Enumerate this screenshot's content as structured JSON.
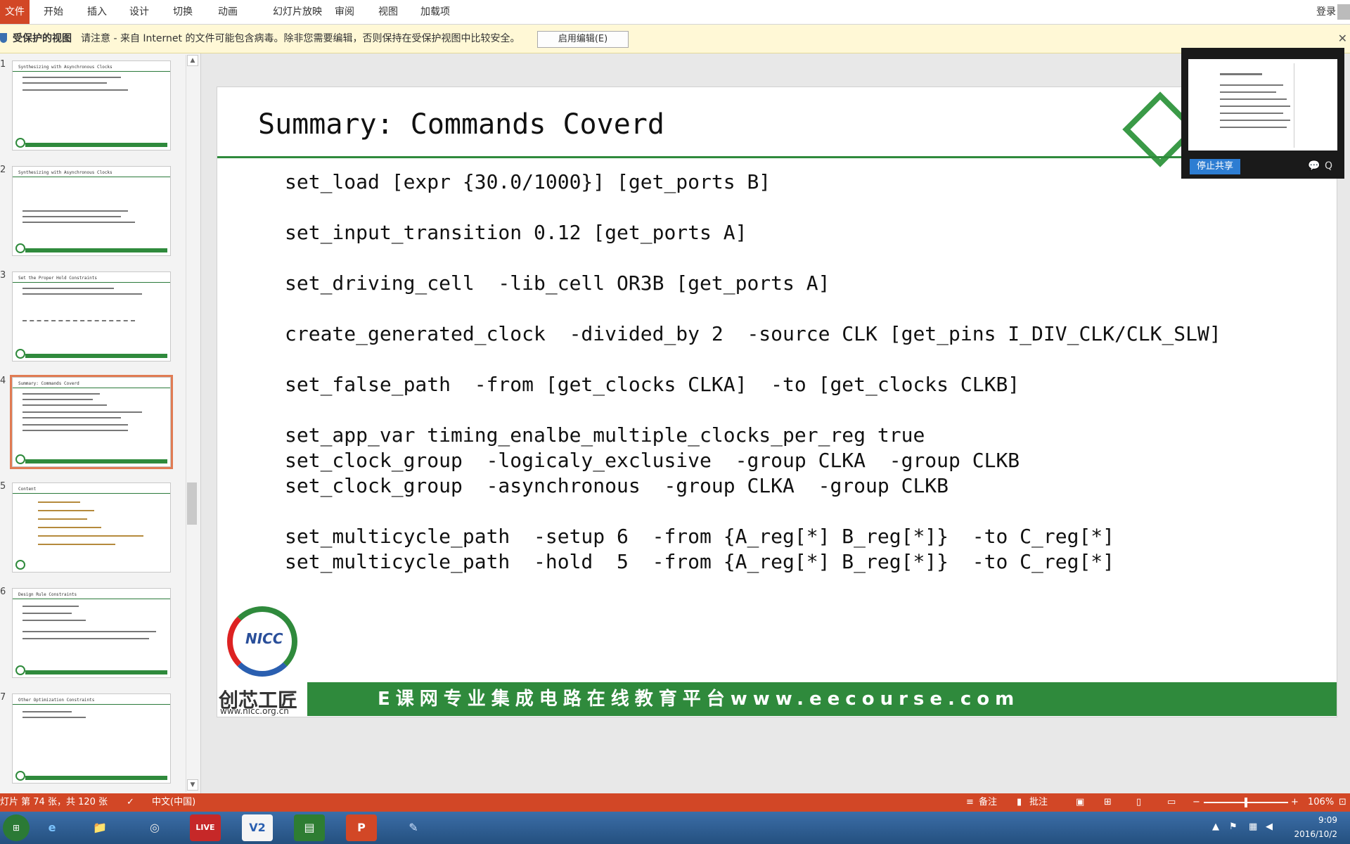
{
  "ribbon": {
    "file_label": "文件",
    "tabs": [
      "开始",
      "插入",
      "设计",
      "切换",
      "动画",
      "幻灯片放映",
      "审阅",
      "视图",
      "加载项"
    ],
    "login_label": "登录"
  },
  "protected_view": {
    "title": "受保护的视图",
    "message": "请注意 - 来自 Internet 的文件可能包含病毒。除非您需要编辑，否则保持在受保护视图中比较安全。",
    "enable_button": "启用编辑(E)",
    "close_icon": "close-icon"
  },
  "thumbnails": [
    {
      "number": "1",
      "title": "Synthesizing with Asynchronous Clocks"
    },
    {
      "number": "2",
      "title": "Synthesizing with Asynchronous Clocks"
    },
    {
      "number": "3",
      "title": "Set the Proper Hold Constraints"
    },
    {
      "number": "4",
      "title": "Summary: Commands Coverd"
    },
    {
      "number": "5",
      "title": "Content"
    },
    {
      "number": "6",
      "title": "Design Rule Constraints"
    },
    {
      "number": "7",
      "title": "Other Optimization Constraints"
    }
  ],
  "slide": {
    "title": "Summary: Commands Coverd",
    "commands": [
      "set_load [expr {30.0/1000}] [get_ports B]",
      "set_input_transition 0.12 [get_ports A]",
      "set_driving_cell  -lib_cell OR3B [get_ports A]",
      "create_generated_clock  -divided_by 2  -source CLK [get_pins I_DIV_CLK/CLK_SLW]",
      "set_false_path  -from [get_clocks CLKA]  -to [get_clocks CLKB]",
      "set_app_var timing_enalbe_multiple_clocks_per_reg true",
      "set_clock_group  -logicaly_exclusive  -group CLKA  -group CLKB",
      "set_clock_group  -asynchronous  -group CLKA  -group CLKB",
      "set_multicycle_path  -setup 6  -from {A_reg[*] B_reg[*]}  -to C_reg[*]",
      "set_multicycle_path  -hold  5  -from {A_reg[*] B_reg[*]}  -to C_reg[*]"
    ],
    "logo_text": "NICC",
    "logo_cn": "创芯工匠",
    "logo_url": "www.nicc.org.cn",
    "banner": "E课网专业集成电路在线教育平台www.eecourse.com"
  },
  "webcam": {
    "stop_share": "停止共享",
    "screen_title": "Summary: Commands Coverd"
  },
  "status": {
    "slide_info": "灯片 第 74 张，共 120 张",
    "language": "中文(中国)",
    "notes": "备注",
    "comments": "批注",
    "zoom": "106%"
  },
  "taskbar": {
    "apps": [
      "e",
      "📁",
      "◎",
      "LIVE",
      "V2",
      "▤",
      "P",
      "✎"
    ],
    "time": "9:09",
    "date": "2016/10/2"
  },
  "colors": {
    "accent": "#d24726",
    "slide_green": "#2f8a3c",
    "selected_thumb": "#e07b53"
  }
}
